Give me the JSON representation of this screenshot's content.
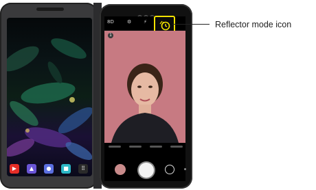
{
  "callout": {
    "label": "Reflector mode icon"
  },
  "left_screen": {
    "dock_apps": [
      {
        "icon": "youtube-icon",
        "color": "#e52d27"
      },
      {
        "icon": "gallery-icon",
        "color": "#6a55d6"
      },
      {
        "icon": "game-launcher-icon",
        "color": "#5b6fe0"
      },
      {
        "icon": "smartworld-icon",
        "color": "#2cb7c6"
      },
      {
        "icon": "apps-grid-icon",
        "color": "#2a2a2a"
      }
    ]
  },
  "camera": {
    "top_icons": [
      "timer-icon",
      "settings-icon",
      "flash-icon",
      "reflector-icon"
    ],
    "top_icon_glyphs": [
      "8D",
      "⚙",
      "⚡"
    ],
    "badge": "1",
    "highlight_color": "#f2e200",
    "preview_bg": "#c77a82"
  }
}
